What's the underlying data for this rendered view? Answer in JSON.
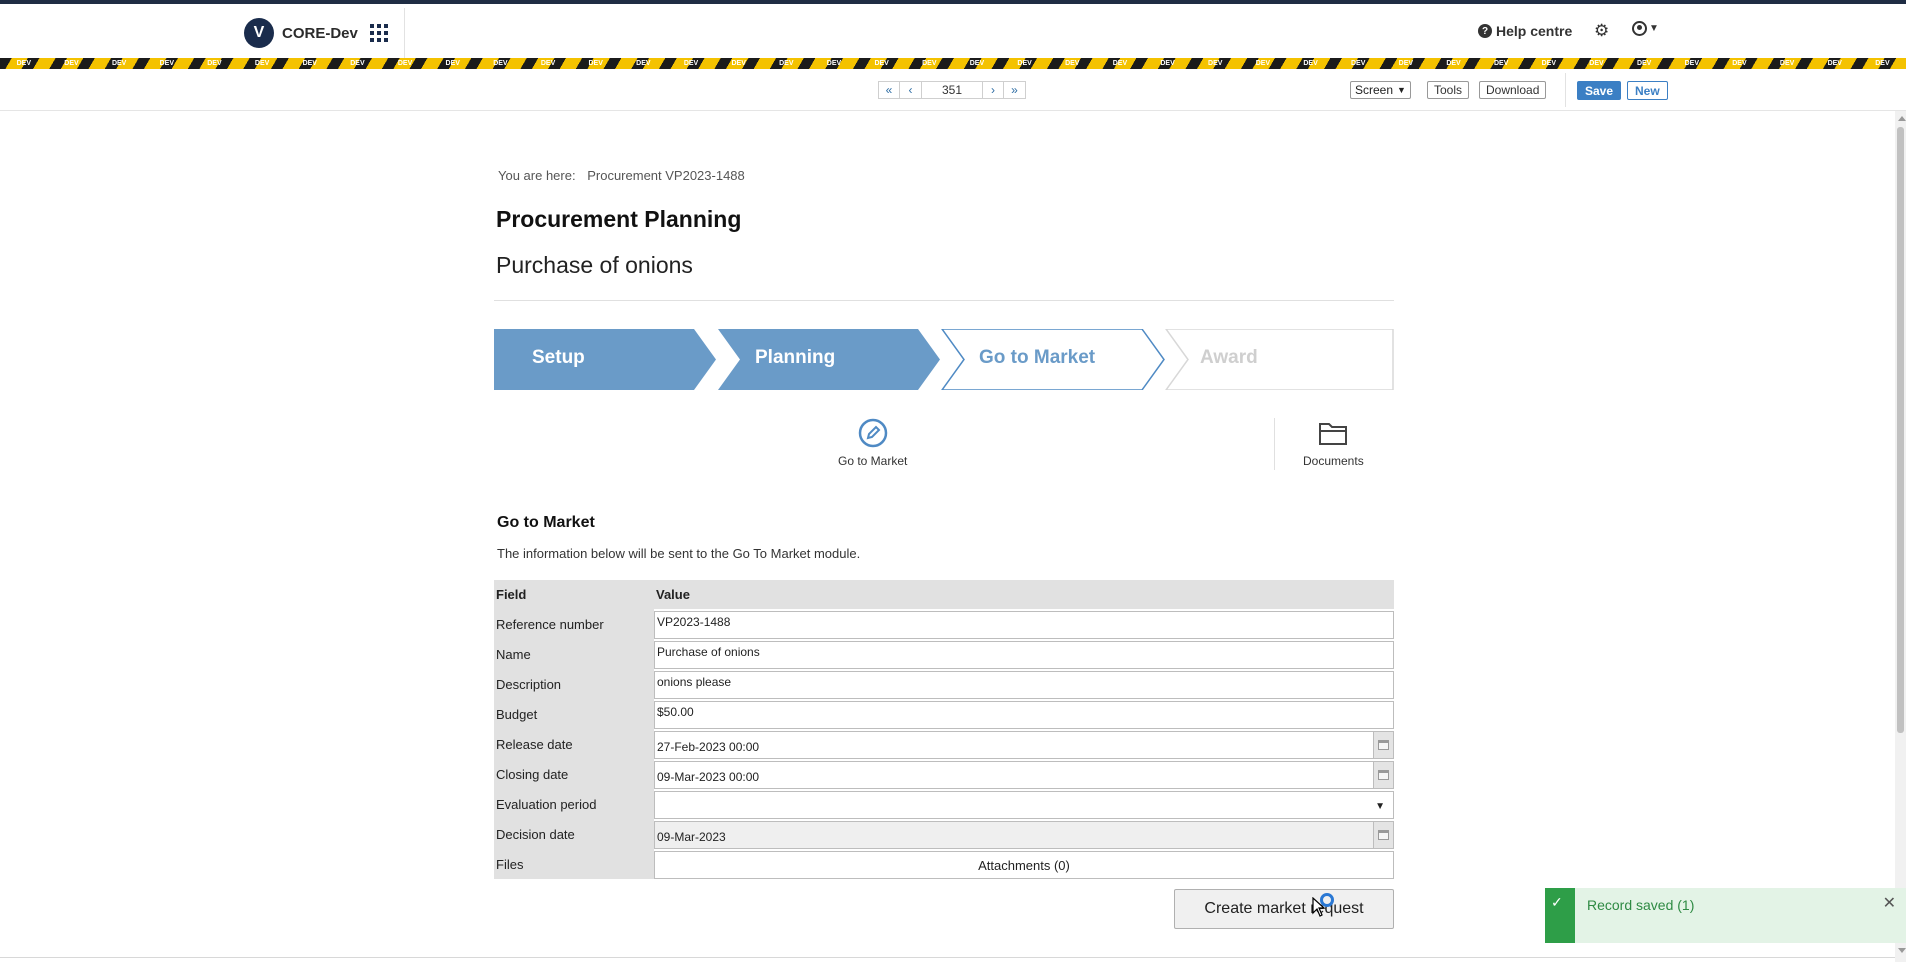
{
  "header": {
    "app_name": "CORE-Dev",
    "logo_letter": "V",
    "help_label": "Help centre",
    "icons": [
      "apps-grid-icon",
      "question-circle-icon",
      "gear-icon",
      "user-circle-icon",
      "chevron-down-icon"
    ],
    "dev_banner_label": "DEV"
  },
  "toolbar": {
    "record_number": "351",
    "view_select": "Screen",
    "tools_label": "Tools",
    "download_label": "Download",
    "save_label": "Save",
    "new_label": "New"
  },
  "breadcrumb": {
    "prefix": "You are here:",
    "current": "Procurement VP2023-1488"
  },
  "page": {
    "title": "Procurement Planning",
    "subtitle": "Purchase of onions"
  },
  "steps": [
    {
      "label": "Setup",
      "state": "complete"
    },
    {
      "label": "Planning",
      "state": "complete"
    },
    {
      "label": "Go to Market",
      "state": "current"
    },
    {
      "label": "Award",
      "state": "pending"
    }
  ],
  "actions": [
    {
      "label": "Go to Market",
      "icon": "pencil-circle-icon"
    },
    {
      "label": "Documents",
      "icon": "folder-icon"
    }
  ],
  "section": {
    "title": "Go to Market",
    "description": "The information below will be sent to the Go To Market module."
  },
  "form_table": {
    "headers": [
      "Field",
      "Value"
    ],
    "rows": [
      {
        "field": "Reference number",
        "value": "VP2023-1488"
      },
      {
        "field": "Name",
        "value": "Purchase of onions"
      },
      {
        "field": "Description",
        "value": "onions please"
      },
      {
        "field": "Budget",
        "value": "$50.00"
      },
      {
        "field": "Release date",
        "value": "27-Feb-2023 00:00"
      },
      {
        "field": "Closing date",
        "value": "09-Mar-2023 00:00"
      },
      {
        "field": "Evaluation period",
        "value": ""
      },
      {
        "field": "Decision date",
        "value": "09-Mar-2023"
      },
      {
        "field": "Files",
        "value": "Attachments (0)"
      }
    ]
  },
  "create_button_label": "Create market request",
  "toast": {
    "message": "Record saved (1)"
  },
  "colors": {
    "brand_navy": "#1a2c4c",
    "step_complete": "#6a9bc8",
    "step_current_border": "#4f8ac4",
    "primary_blue": "#3b7fc4",
    "toast_green": "#2e9e48"
  }
}
